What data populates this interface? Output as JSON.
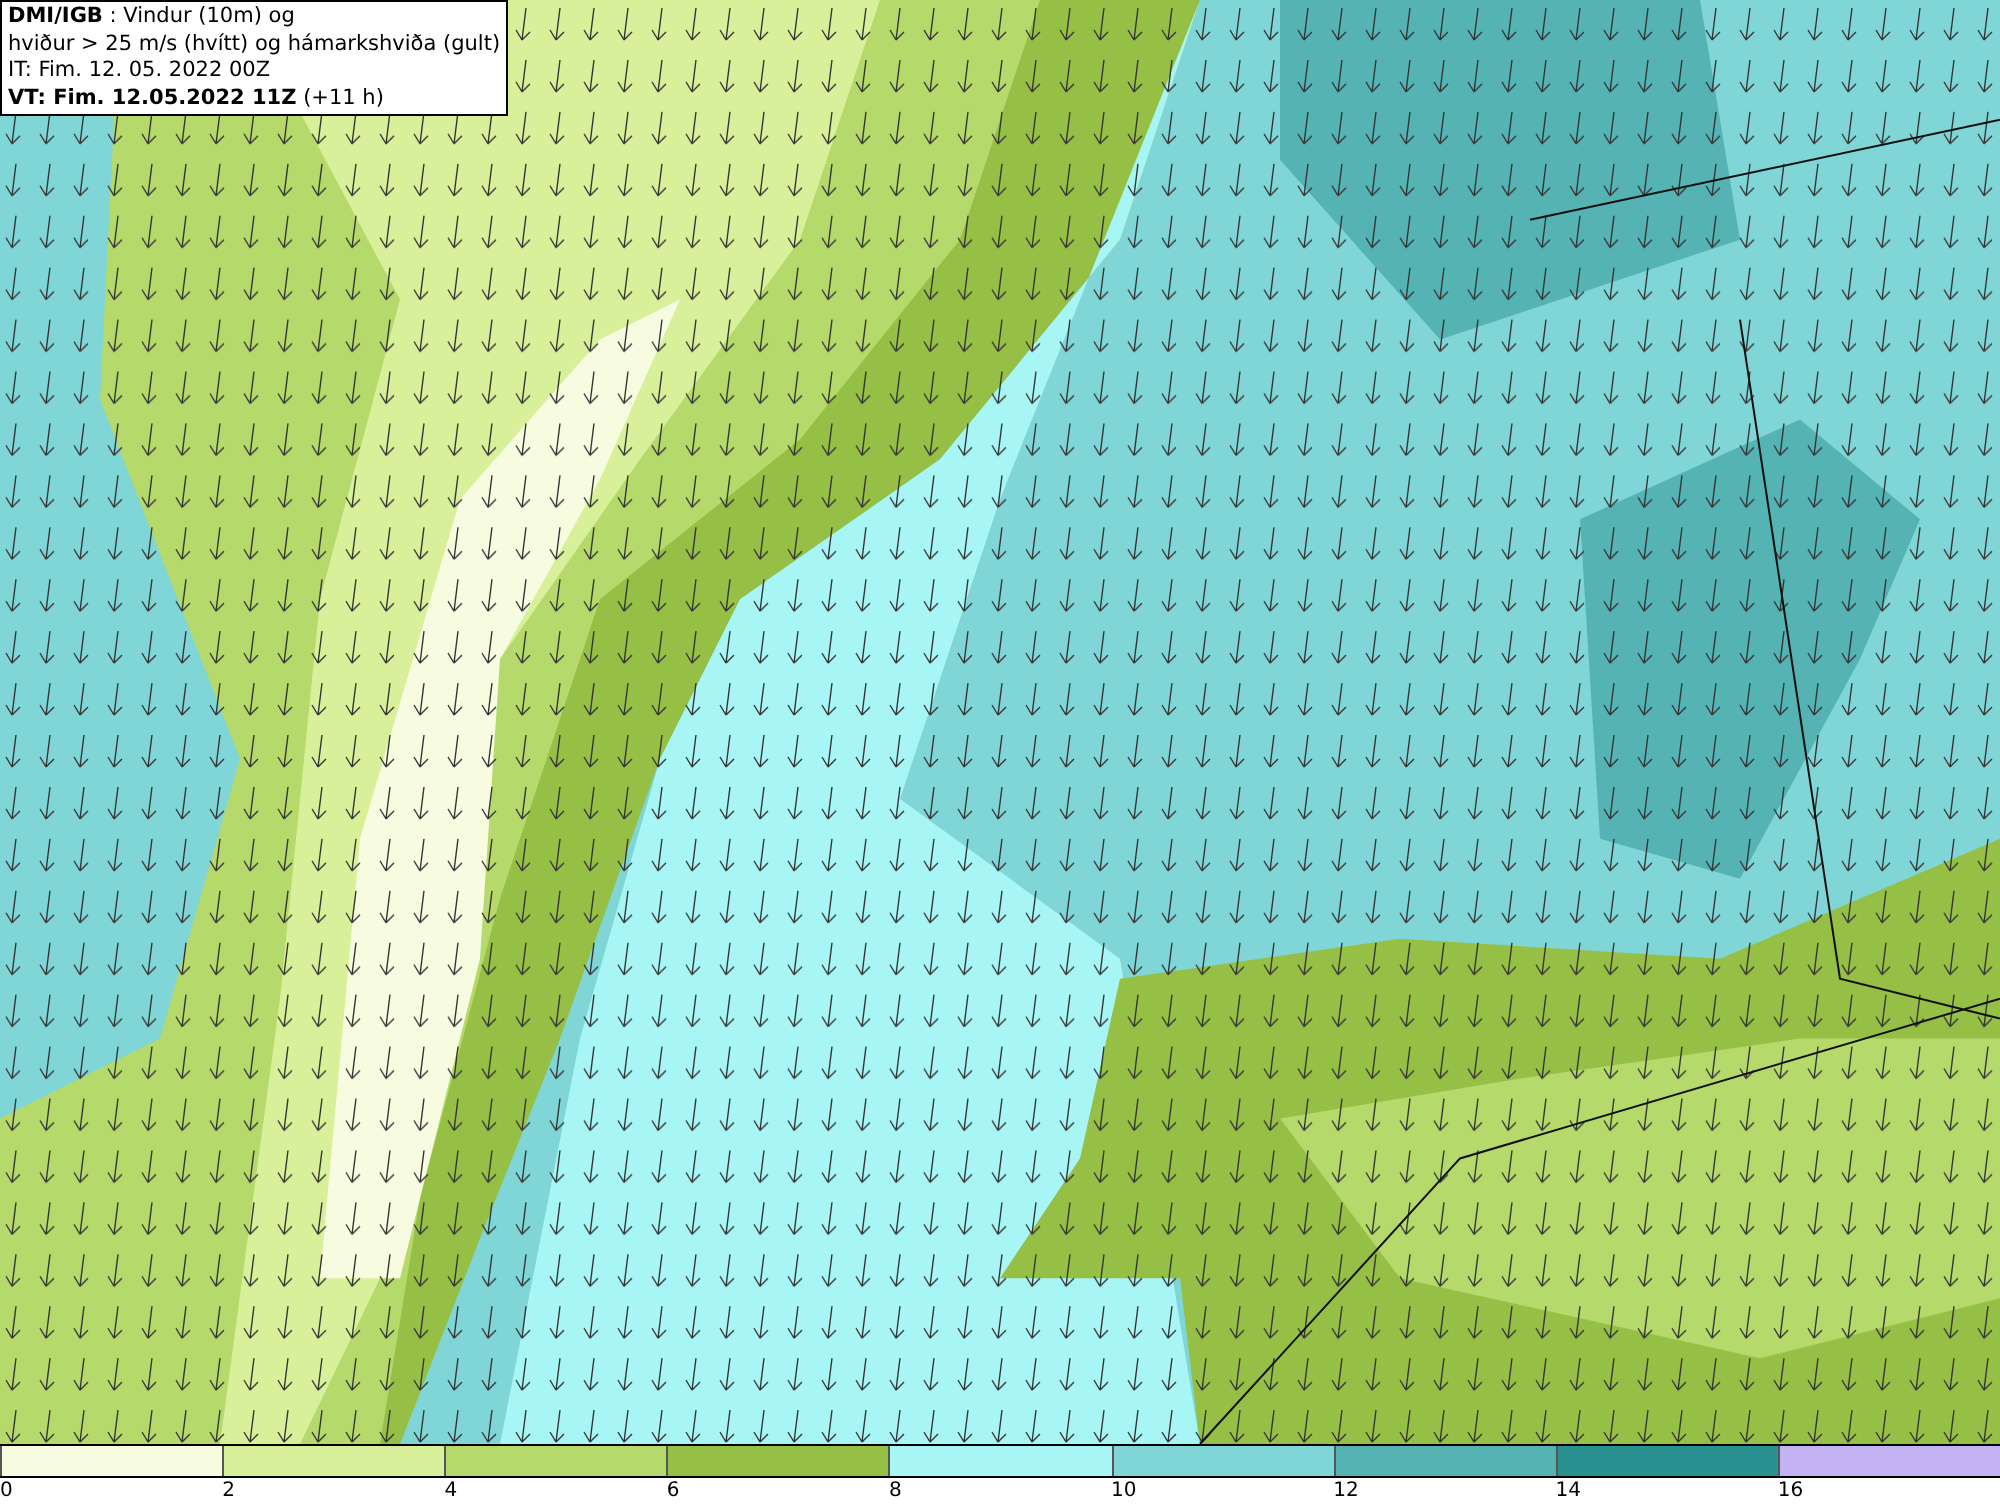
{
  "info_box": {
    "lines": [
      "**DMI/IGB** : Vindur (10m) og",
      "hviður > 25 m/s (hvítt) og hámarkshviða (gult)",
      "IT: Fim. 12. 05. 2022 00Z",
      "**VT: Fim. 12.05.2022 11Z** (+11 h)"
    ]
  },
  "legend": {
    "segments": [
      {
        "color": "#f7fbe0"
      },
      {
        "color": "#d9f09a"
      },
      {
        "color": "#b5d96a"
      },
      {
        "color": "#95bf45"
      },
      {
        "color": "#a8f5f5"
      },
      {
        "color": "#80d6d6"
      },
      {
        "color": "#55b3b3"
      },
      {
        "color": "#2a9191"
      },
      {
        "color": "#c3b3f5"
      }
    ],
    "labels": [
      "0",
      "2",
      "4",
      "6",
      "8",
      "10",
      "12",
      "14",
      "16"
    ]
  }
}
